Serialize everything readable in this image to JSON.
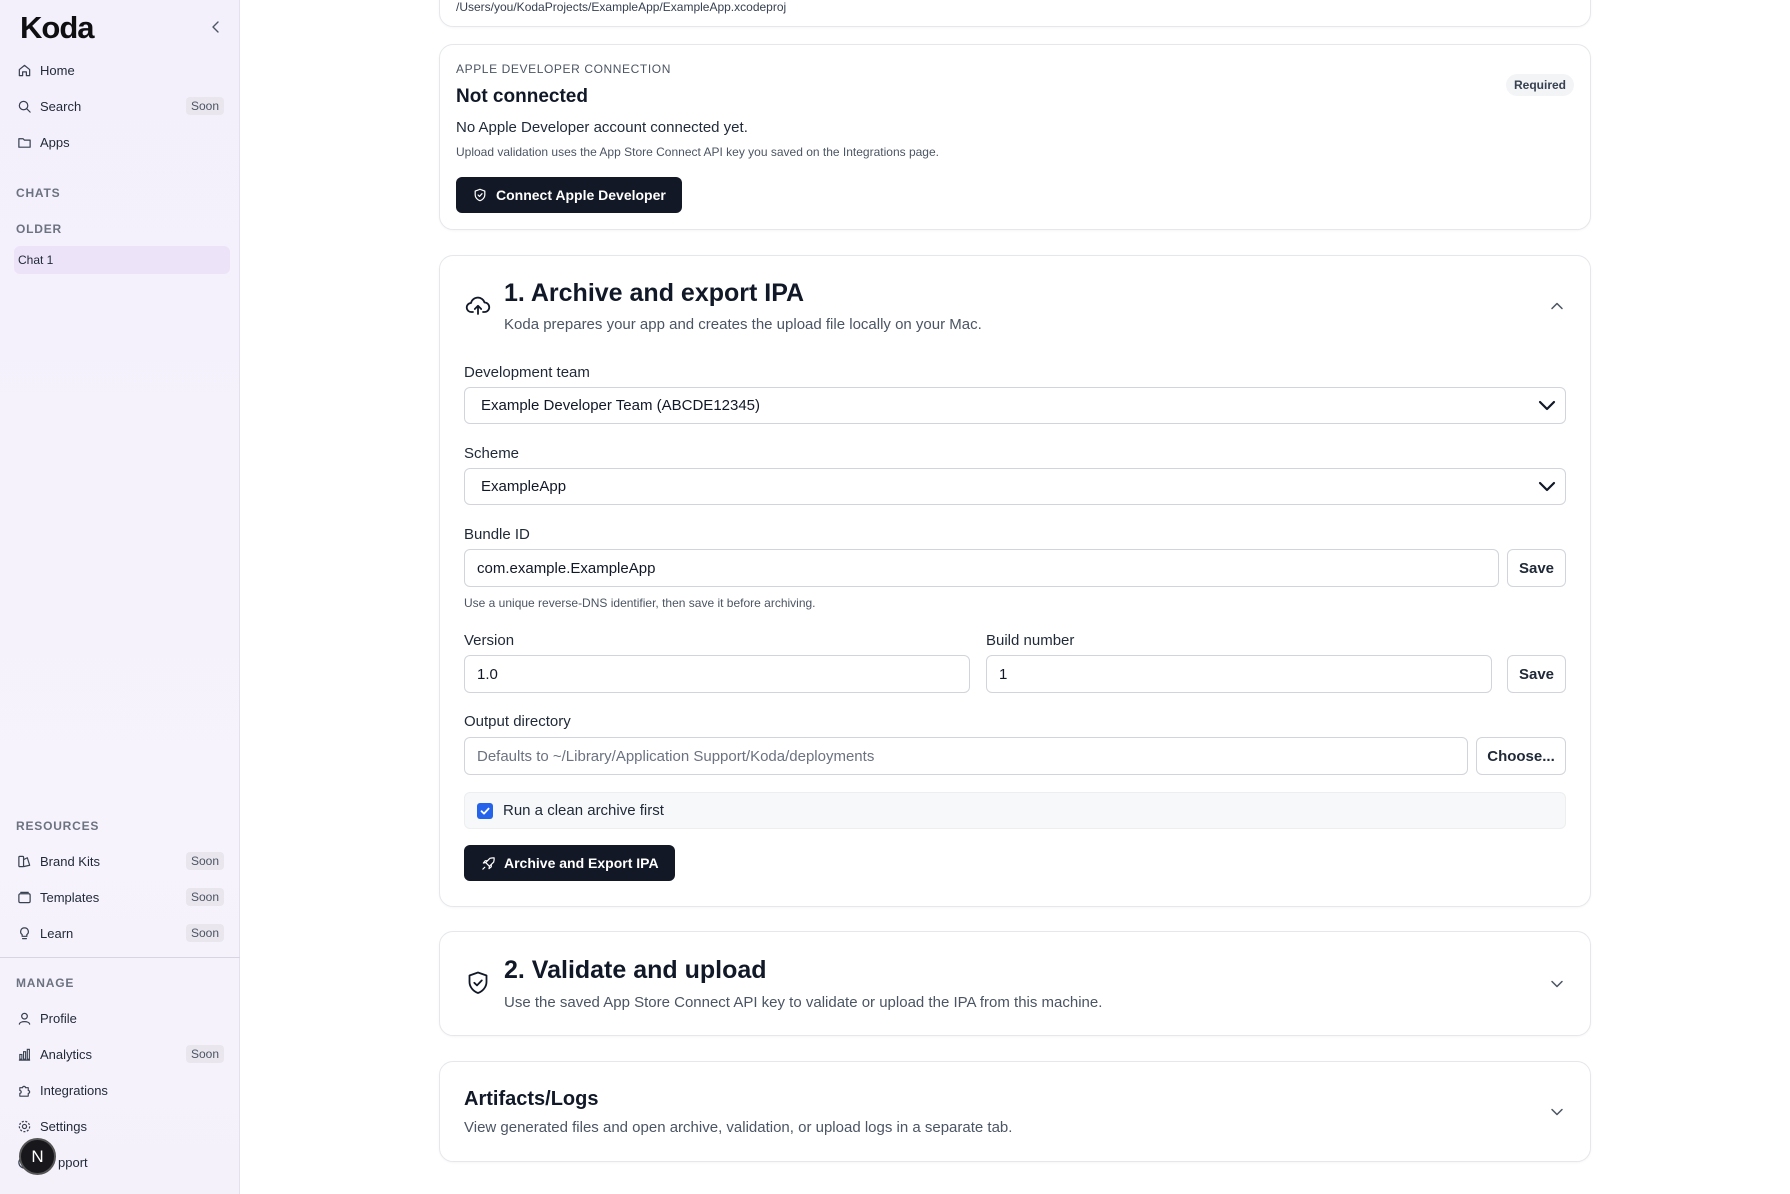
{
  "sidebar": {
    "logo": "Koda",
    "nav": [
      {
        "label": "Home",
        "icon": "home-icon"
      },
      {
        "label": "Search",
        "icon": "search-icon",
        "badge": "Soon"
      },
      {
        "label": "Apps",
        "icon": "folder-icon"
      }
    ],
    "chats_label": "CHATS",
    "older_label": "OLDER",
    "chat_items": [
      {
        "label": "Chat 1"
      }
    ],
    "resources_label": "RESOURCES",
    "resources": [
      {
        "label": "Brand Kits",
        "icon": "brand-kits-icon",
        "badge": "Soon"
      },
      {
        "label": "Templates",
        "icon": "templates-icon",
        "badge": "Soon"
      },
      {
        "label": "Learn",
        "icon": "lightbulb-icon",
        "badge": "Soon"
      }
    ],
    "manage_label": "MANAGE",
    "manage": [
      {
        "label": "Profile",
        "icon": "user-icon"
      },
      {
        "label": "Analytics",
        "icon": "bar-chart-icon",
        "badge": "Soon"
      },
      {
        "label": "Integrations",
        "icon": "puzzle-icon"
      },
      {
        "label": "Settings",
        "icon": "gear-icon"
      },
      {
        "label": "Support",
        "visible_text": "pport",
        "icon": "help-icon"
      }
    ],
    "avatar_initial": "N"
  },
  "project": {
    "path": "/Users/you/KodaProjects/ExampleApp/ExampleApp.xcodeproj"
  },
  "apple_connection": {
    "eyebrow": "APPLE DEVELOPER CONNECTION",
    "title": "Not connected",
    "badge": "Required",
    "description": "No Apple Developer account connected yet.",
    "note": "Upload validation uses the App Store Connect API key you saved on the Integrations page.",
    "button_label": "Connect Apple Developer"
  },
  "archive": {
    "title": "1. Archive and export IPA",
    "subtitle": "Koda prepares your app and creates the upload file locally on your Mac.",
    "team_label": "Development team",
    "team_value": "Example Developer Team (ABCDE12345)",
    "scheme_label": "Scheme",
    "scheme_value": "ExampleApp",
    "bundle_label": "Bundle ID",
    "bundle_value": "com.example.ExampleApp",
    "save_label": "Save",
    "bundle_hint": "Use a unique reverse-DNS identifier, then save it before archiving.",
    "version_label": "Version",
    "version_value": "1.0",
    "build_label": "Build number",
    "build_value": "1",
    "output_label": "Output directory",
    "output_placeholder": "Defaults to ~/Library/Application Support/Koda/deployments",
    "choose_label": "Choose...",
    "clean_archive_label": "Run a clean archive first",
    "clean_archive_checked": true,
    "archive_button_label": "Archive and Export IPA"
  },
  "validate": {
    "title": "2. Validate and upload",
    "subtitle": "Use the saved App Store Connect API key to validate or upload the IPA from this machine."
  },
  "artifacts": {
    "title": "Artifacts/Logs",
    "subtitle": "View generated files and open archive, validation, or upload logs in a separate tab."
  },
  "colors": {
    "accent_dark": "#121826",
    "checkbox_blue": "#2563eb",
    "active_chat_bg": "#ece3f9"
  }
}
